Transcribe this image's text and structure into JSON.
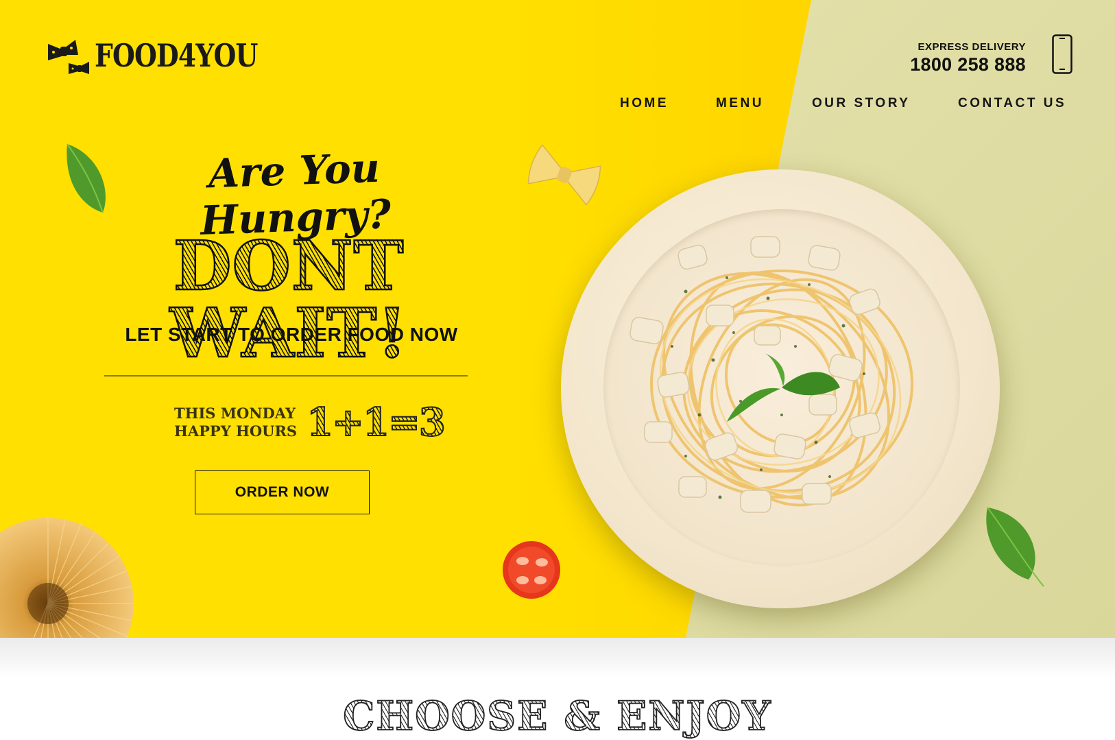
{
  "brand": {
    "name": "FOOD4YOU",
    "logo_icon": "bow-tie-pasta-icon"
  },
  "header": {
    "delivery_label": "EXPRESS DELIVERY",
    "delivery_phone": "1800 258 888",
    "phone_icon": "smartphone-icon"
  },
  "nav": {
    "home": "HOME",
    "menu": "MENU",
    "our_story": "OUR STORY",
    "contact_us": "CONTACT US"
  },
  "hero": {
    "tagline": "Are You Hungry?",
    "headline": "DONT WAIT!",
    "subhead": "LET START TO ORDER FOOD NOW",
    "promo_line1": "THIS MONDAY",
    "promo_line2": "HAPPY HOURS",
    "promo_equation": "1+1=3",
    "order_button": "ORDER NOW"
  },
  "section": {
    "title": "CHOOSE & ENJOY"
  },
  "colors": {
    "hero_yellow": "#ffe000",
    "hero_green": "#dedd9c",
    "text_dark": "#111111"
  }
}
